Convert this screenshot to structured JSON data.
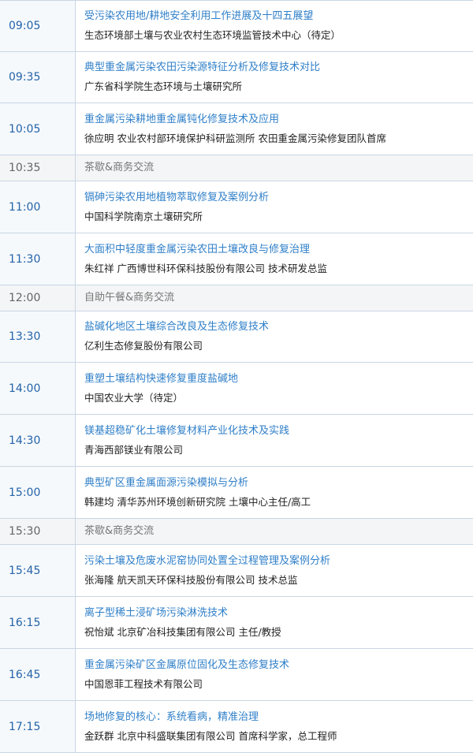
{
  "schedule": {
    "rows": [
      {
        "type": "talk",
        "time": "09:05",
        "title": "受污染农用地/耕地安全利用工作进展及十四五展望",
        "speaker": "生态环境部土壤与农业农村生态环境监管技术中心（待定）"
      },
      {
        "type": "talk",
        "time": "09:35",
        "title": "典型重金属污染农田污染源特征分析及修复技术对比",
        "speaker": "广东省科学院生态环境与土壤研究所"
      },
      {
        "type": "talk",
        "time": "10:05",
        "title": "重金属污染耕地重金属钝化修复技术及应用",
        "speaker": "徐应明 农业农村部环境保护科研监测所 农田重金属污染修复团队首席"
      },
      {
        "type": "break",
        "time": "10:35",
        "label": "茶歇&商务交流"
      },
      {
        "type": "talk",
        "time": "11:00",
        "title": "镉砷污染农用地植物萃取修复及案例分析",
        "speaker": "中国科学院南京土壤研究所"
      },
      {
        "type": "talk",
        "time": "11:30",
        "title": "大面积中轻度重金属污染农田土壤改良与修复治理",
        "speaker": "朱红祥 广西博世科环保科技股份有限公司 技术研发总监"
      },
      {
        "type": "break",
        "time": "12:00",
        "label": "自助午餐&商务交流"
      },
      {
        "type": "talk",
        "time": "13:30",
        "title": "盐碱化地区土壤综合改良及生态修复技术",
        "speaker": "亿利生态修复股份有限公司"
      },
      {
        "type": "talk",
        "time": "14:00",
        "title": "重塑土壤结构快速修复重度盐碱地",
        "speaker": "中国农业大学（待定）"
      },
      {
        "type": "talk",
        "time": "14:30",
        "title": "镁基超稳矿化土壤修复材料产业化技术及实践",
        "speaker": "青海西部镁业有限公司"
      },
      {
        "type": "talk",
        "time": "15:00",
        "title": "典型矿区重金属面源污染模拟与分析",
        "speaker": "韩建均 清华苏州环境创新研究院  土壤中心主任/高工"
      },
      {
        "type": "break",
        "time": "15:30",
        "label": "茶歇&商务交流"
      },
      {
        "type": "talk",
        "time": "15:45",
        "title": "污染土壤及危废水泥窑协同处置全过程管理及案例分析",
        "speaker": "张海隆 航天凯天环保科技股份有限公司 技术总监"
      },
      {
        "type": "talk",
        "time": "16:15",
        "title": "离子型稀土浸矿场污染淋洗技术",
        "speaker": "祝怡斌 北京矿冶科技集团有限公司 主任/教授"
      },
      {
        "type": "talk",
        "time": "16:45",
        "title": "重金属污染矿区金属原位固化及生态修复技术",
        "speaker": "中国恩菲工程技术有限公司"
      },
      {
        "type": "talk",
        "time": "17:15",
        "title": "场地修复的核心：系统看病，精准治理",
        "speaker": "金跃群 北京中科盛联集团有限公司 首席科学家，总工程师"
      }
    ]
  }
}
